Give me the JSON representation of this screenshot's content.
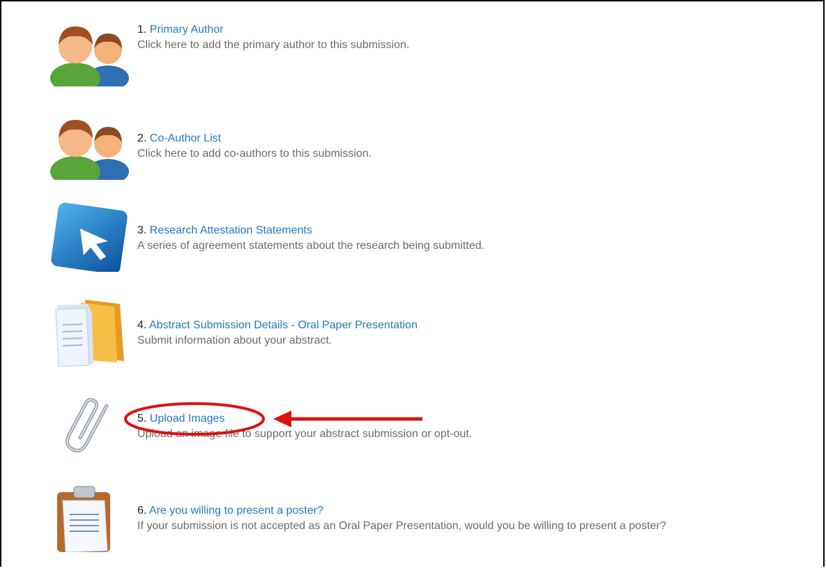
{
  "steps": [
    {
      "number": "1.",
      "title": "Primary Author",
      "description": "Click here to add the primary author to this submission.",
      "icon": "people-icon"
    },
    {
      "number": "2.",
      "title": "Co-Author List",
      "description": "Click here to add co-authors to this submission.",
      "icon": "people-icon"
    },
    {
      "number": "3.",
      "title": "Research Attestation Statements",
      "description": "A series of agreement statements about the research being submitted.",
      "icon": "cursor-arrow-icon"
    },
    {
      "number": "4.",
      "title": "Abstract Submission Details - Oral Paper Presentation",
      "description": "Submit information about your abstract.",
      "icon": "documents-folder-icon"
    },
    {
      "number": "5.",
      "title": "Upload Images",
      "description": "Upload an image file to support your abstract submission or opt-out.",
      "icon": "paperclip-icon"
    },
    {
      "number": "6.",
      "title": "Are you willing to present a poster?",
      "description": "If your submission is not accepted as an Oral Paper Presentation, would you be willing to present a poster?",
      "icon": "clipboard-icon"
    }
  ],
  "colors": {
    "link": "#1f7ac3",
    "annotation": "#e01010",
    "description": "#6b6b6b"
  },
  "annotation": {
    "highlighted_step": "5.",
    "shapes": [
      "circle",
      "arrow"
    ]
  }
}
